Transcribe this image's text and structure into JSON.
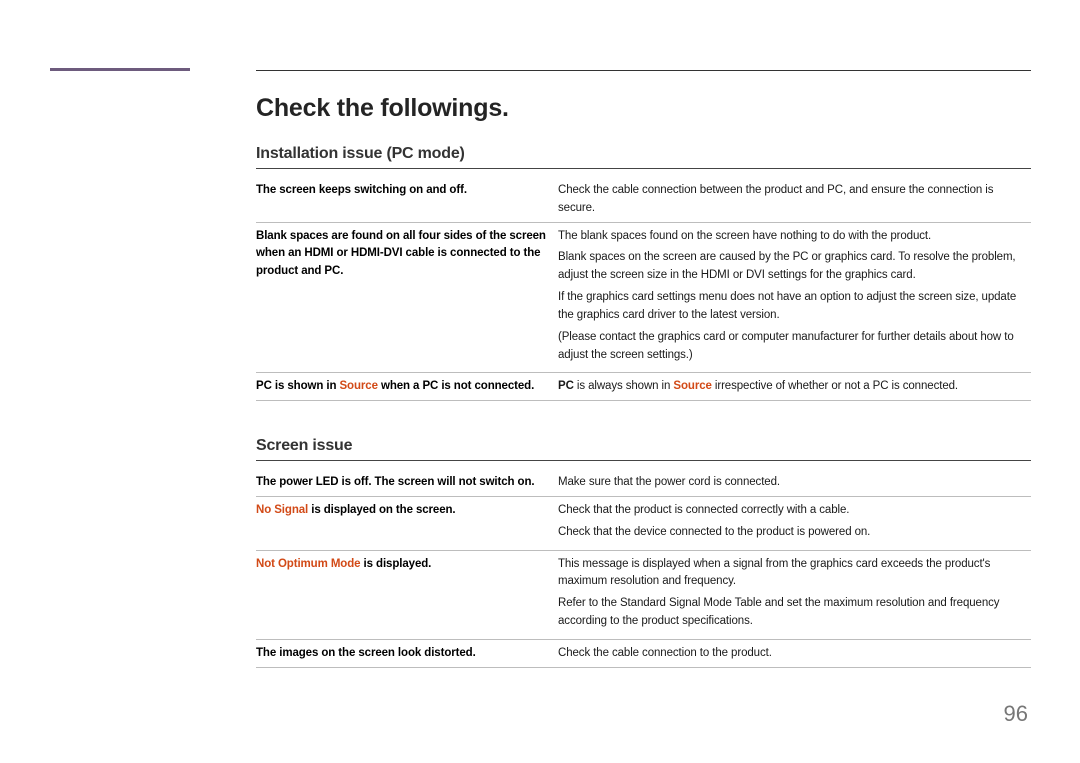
{
  "heading": "Check the followings.",
  "pageNumber": "96",
  "sections": [
    {
      "title": "Installation issue (PC mode)",
      "rows": [
        {
          "leftParts": [
            {
              "text": "The screen keeps switching on and off.",
              "cls": ""
            }
          ],
          "rightParts": [
            {
              "text": "Check the cable connection between the product and PC, and ensure the connection is secure.",
              "cls": ""
            }
          ]
        },
        {
          "leftParts": [
            {
              "text": "Blank spaces are found on all four sides of the screen when an HDMI or HDMI-DVI cable is connected to the product and PC.",
              "cls": ""
            }
          ],
          "rightParas": [
            [
              {
                "text": "The blank spaces found on the screen have nothing to do with the product.",
                "cls": ""
              }
            ],
            [
              {
                "text": "Blank spaces on the screen are caused by the PC or graphics card. To resolve the problem, adjust the screen size in the HDMI or DVI settings for the graphics card.",
                "cls": ""
              }
            ],
            [
              {
                "text": "If the graphics card settings menu does not have an option to adjust the screen size, update the graphics card driver to the latest version.",
                "cls": ""
              }
            ],
            [
              {
                "text": "(Please contact the graphics card or computer manufacturer for further details about how to adjust the screen settings.)",
                "cls": ""
              }
            ]
          ]
        },
        {
          "leftParts": [
            {
              "text": "PC is shown in ",
              "cls": ""
            },
            {
              "text": "Source",
              "cls": "red"
            },
            {
              "text": " when a PC is not connected.",
              "cls": ""
            }
          ],
          "rightParts": [
            {
              "text": "PC",
              "cls": "bold"
            },
            {
              "text": " is always shown in ",
              "cls": ""
            },
            {
              "text": "Source",
              "cls": "red"
            },
            {
              "text": " irrespective of whether or not a PC is connected.",
              "cls": ""
            }
          ]
        }
      ]
    },
    {
      "title": "Screen issue",
      "rows": [
        {
          "leftParts": [
            {
              "text": "The power LED is off. The screen will not switch on.",
              "cls": ""
            }
          ],
          "rightParts": [
            {
              "text": "Make sure that the power cord is connected.",
              "cls": ""
            }
          ]
        },
        {
          "leftParts": [
            {
              "text": "No Signal",
              "cls": "red"
            },
            {
              "text": " is displayed on the screen.",
              "cls": ""
            }
          ],
          "rightParas": [
            [
              {
                "text": "Check that the product is connected correctly with a cable.",
                "cls": ""
              }
            ],
            [
              {
                "text": "Check that the device connected to the product is powered on.",
                "cls": ""
              }
            ]
          ]
        },
        {
          "leftParts": [
            {
              "text": "Not Optimum Mode",
              "cls": "red"
            },
            {
              "text": " is displayed.",
              "cls": ""
            }
          ],
          "rightParas": [
            [
              {
                "text": "This message is displayed when a signal from the graphics card exceeds the product's maximum resolution and frequency.",
                "cls": ""
              }
            ],
            [
              {
                "text": "Refer to the Standard Signal Mode Table and set the maximum resolution and frequency according to the product specifications.",
                "cls": ""
              }
            ]
          ]
        },
        {
          "leftParts": [
            {
              "text": "The images on the screen look distorted.",
              "cls": ""
            }
          ],
          "rightParts": [
            {
              "text": "Check the cable connection to the product.",
              "cls": ""
            }
          ]
        }
      ]
    }
  ]
}
